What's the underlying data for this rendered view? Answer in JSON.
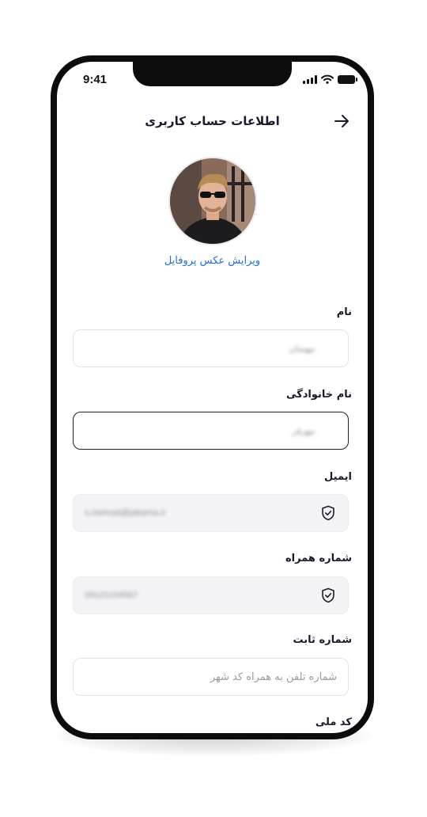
{
  "status_bar": {
    "time": "9:41"
  },
  "header": {
    "title": "اطلاعات حساب کاربری"
  },
  "profile": {
    "edit_photo_label": "ویرایش عکس پروفایل"
  },
  "form": {
    "first_name": {
      "label": "نام",
      "value": "مهسان"
    },
    "last_name": {
      "label": "نام خانوادگی",
      "value": "مهرفر"
    },
    "email": {
      "label": "ایمیل",
      "value": "s.mehrad@jabama.ir"
    },
    "mobile": {
      "label": "شماره همراه",
      "value": "09121234567"
    },
    "landline": {
      "label": "شماره ثابت",
      "placeholder": "شماره تلفن به همراه کد شهر"
    },
    "national_id": {
      "label": "کد ملی"
    }
  },
  "icons": {
    "back": "arrow-right-icon",
    "verified": "shield-check-icon",
    "signal": "signal-icon",
    "wifi": "wifi-icon",
    "battery": "battery-icon"
  },
  "colors": {
    "link": "#1e6fd9",
    "text": "#1a1a2e",
    "focus_border": "#1a2233",
    "filled_bg": "#f4f4f6"
  }
}
